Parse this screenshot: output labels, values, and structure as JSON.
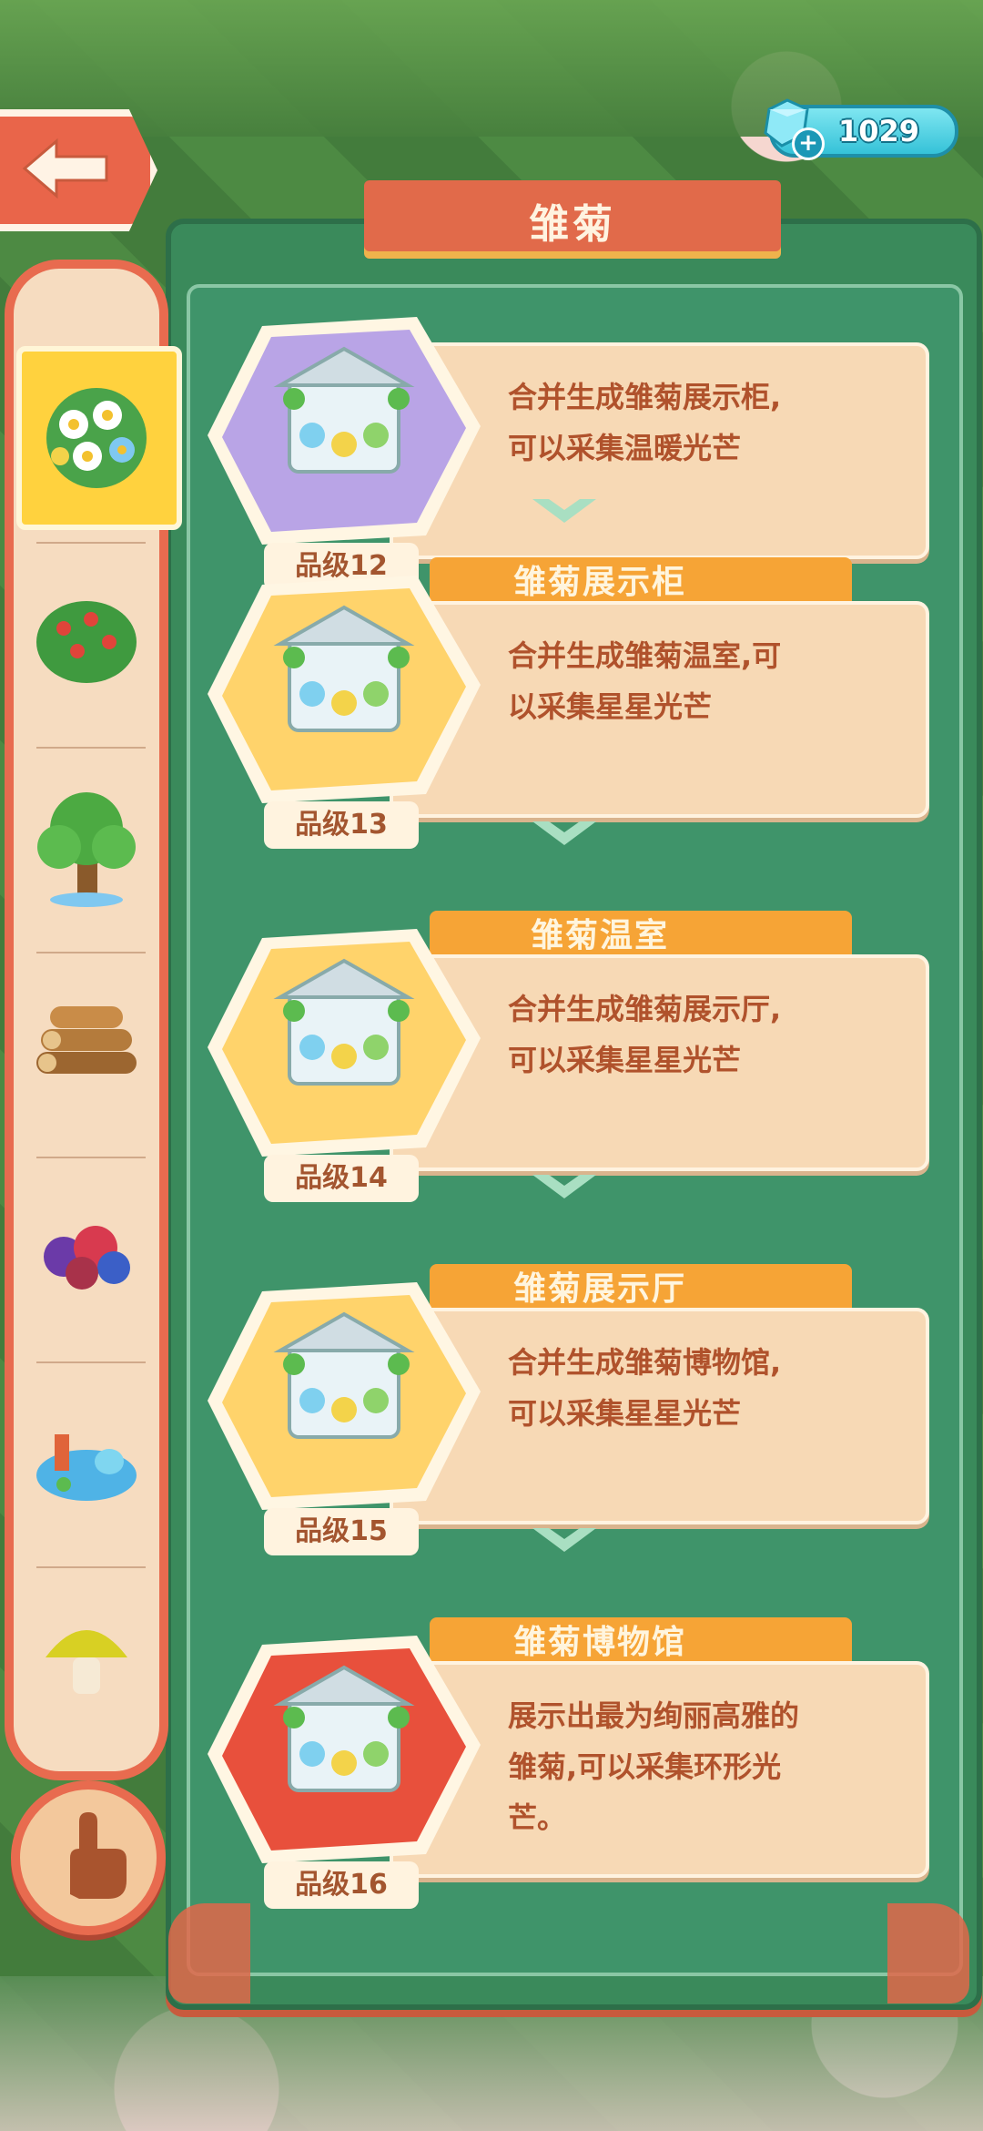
{
  "currency": {
    "value": "1029"
  },
  "panel": {
    "title": "雏菊"
  },
  "sidebar": {
    "categories": [
      {
        "icon": "daisy-bouquet-icon",
        "active": true
      },
      {
        "icon": "berry-bush-icon",
        "active": false
      },
      {
        "icon": "tree-icon",
        "active": false
      },
      {
        "icon": "wood-logs-icon",
        "active": false
      },
      {
        "icon": "berries-pile-icon",
        "active": false
      },
      {
        "icon": "pond-icon",
        "active": false
      },
      {
        "icon": "mushroom-icon",
        "active": false
      }
    ]
  },
  "entries": [
    {
      "name": "",
      "desc_lines": [
        "合并生成雏菊展示柜,",
        "可以采集温暖光芒"
      ],
      "grade": "品级12",
      "hex_color": "#b9a4e6"
    },
    {
      "name": "雏菊展示柜",
      "desc_lines": [
        "合并生成雏菊温室,可",
        "以采集星星光芒"
      ],
      "grade": "品级13",
      "hex_color": "#ffd36b"
    },
    {
      "name": "雏菊温室",
      "desc_lines": [
        "合并生成雏菊展示厅,",
        "可以采集星星光芒"
      ],
      "grade": "品级14",
      "hex_color": "#ffd36b"
    },
    {
      "name": "雏菊展示厅",
      "desc_lines": [
        "合并生成雏菊博物馆,",
        "可以采集星星光芒"
      ],
      "grade": "品级15",
      "hex_color": "#ffd36b"
    },
    {
      "name": "雏菊博物馆",
      "desc_lines": [
        "展示出最为绚丽高雅的",
        "雏菊,可以采集环形光",
        "芒。"
      ],
      "grade": "品级16",
      "hex_color": "#e8503c"
    }
  ]
}
